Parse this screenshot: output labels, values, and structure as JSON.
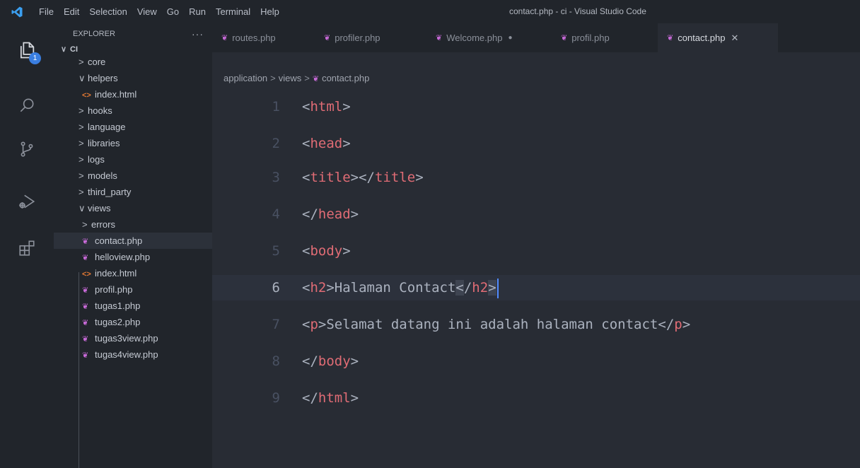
{
  "window": {
    "title": "contact.php - ci - Visual Studio Code",
    "menu": [
      "File",
      "Edit",
      "Selection",
      "View",
      "Go",
      "Run",
      "Terminal",
      "Help"
    ]
  },
  "activity": {
    "items": [
      "explorer-icon",
      "search-icon",
      "source-control-icon",
      "run-debug-icon",
      "extensions-icon"
    ],
    "explorer_badge": "1"
  },
  "sidebar": {
    "header": "EXPLORER",
    "more": "···",
    "root": "CI",
    "tree": [
      {
        "label": "core",
        "type": "folder",
        "open": false,
        "depth": 1
      },
      {
        "label": "helpers",
        "type": "folder",
        "open": true,
        "depth": 1
      },
      {
        "label": "index.html",
        "type": "html",
        "depth": 2
      },
      {
        "label": "hooks",
        "type": "folder",
        "open": false,
        "depth": 1
      },
      {
        "label": "language",
        "type": "folder",
        "open": false,
        "depth": 1
      },
      {
        "label": "libraries",
        "type": "folder",
        "open": false,
        "depth": 1
      },
      {
        "label": "logs",
        "type": "folder",
        "open": false,
        "depth": 1
      },
      {
        "label": "models",
        "type": "folder",
        "open": false,
        "depth": 1
      },
      {
        "label": "third_party",
        "type": "folder",
        "open": false,
        "depth": 1
      },
      {
        "label": "views",
        "type": "folder",
        "open": true,
        "depth": 1
      },
      {
        "label": "errors",
        "type": "folder",
        "open": false,
        "depth": 2
      },
      {
        "label": "contact.php",
        "type": "php",
        "depth": 2,
        "selected": true
      },
      {
        "label": "helloview.php",
        "type": "php",
        "depth": 2
      },
      {
        "label": "index.html",
        "type": "html",
        "depth": 2
      },
      {
        "label": "profil.php",
        "type": "php",
        "depth": 2
      },
      {
        "label": "tugas1.php",
        "type": "php",
        "depth": 2
      },
      {
        "label": "tugas2.php",
        "type": "php",
        "depth": 2
      },
      {
        "label": "tugas3view.php",
        "type": "php",
        "depth": 2
      },
      {
        "label": "tugas4view.php",
        "type": "php",
        "depth": 2
      }
    ]
  },
  "tabs": [
    {
      "label": "routes.php",
      "active": false,
      "dirty": false
    },
    {
      "label": "profiler.php",
      "active": false,
      "dirty": false
    },
    {
      "label": "Welcome.php",
      "active": false,
      "dirty": true
    },
    {
      "label": "profil.php",
      "active": false,
      "dirty": false
    },
    {
      "label": "contact.php",
      "active": true,
      "dirty": false
    }
  ],
  "breadcrumb": [
    "application",
    "views",
    "contact.php"
  ],
  "editor": {
    "current_line": 6,
    "lines": [
      {
        "num": "1",
        "tag": "html",
        "closing": false
      },
      {
        "num": "2",
        "tag": "head",
        "closing": false
      },
      {
        "num": "3",
        "tag": "title",
        "closing": false,
        "pair": true
      },
      {
        "num": "4",
        "tag": "head",
        "closing": true
      },
      {
        "num": "5",
        "tag": "body",
        "closing": false
      },
      {
        "num": "6",
        "tag": "h2",
        "content": "Halaman Contact"
      },
      {
        "num": "7",
        "tag": "p",
        "content": "Selamat datang ini adalah halaman contact"
      },
      {
        "num": "8",
        "tag": "body",
        "closing": true
      },
      {
        "num": "9",
        "tag": "html",
        "closing": true
      }
    ]
  }
}
